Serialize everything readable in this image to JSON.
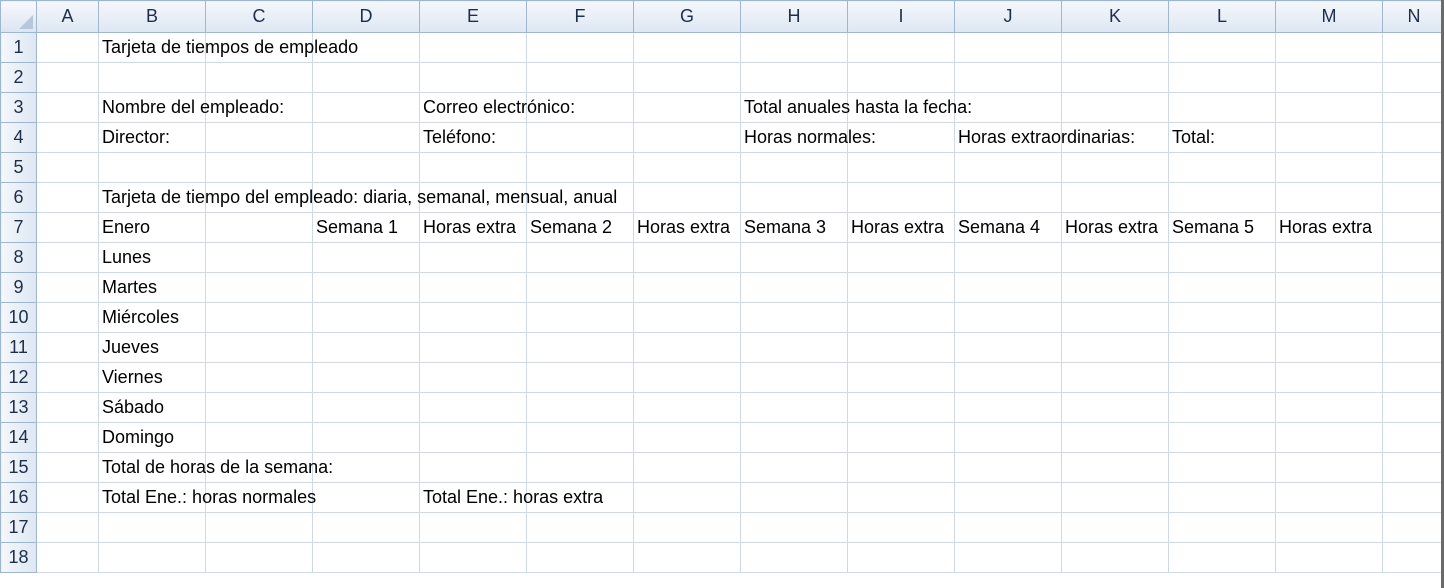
{
  "columns": [
    "A",
    "B",
    "C",
    "D",
    "E",
    "F",
    "G",
    "H",
    "I",
    "J",
    "K",
    "L",
    "M",
    "N"
  ],
  "rows": [
    {
      "num": "1",
      "cells": {
        "B": "Tarjeta de tiempos de empleado"
      }
    },
    {
      "num": "2",
      "cells": {}
    },
    {
      "num": "3",
      "cells": {
        "B": "Nombre del empleado:",
        "E": "Correo electrónico:",
        "H": "Total anuales hasta la fecha:"
      }
    },
    {
      "num": "4",
      "cells": {
        "B": "Director:",
        "E": "Teléfono:",
        "H": "Horas normales:",
        "J": "Horas extraordinarias:",
        "L": "Total:"
      }
    },
    {
      "num": "5",
      "cells": {}
    },
    {
      "num": "6",
      "cells": {
        "B": "Tarjeta de tiempo del empleado: diaria, semanal, mensual, anual"
      }
    },
    {
      "num": "7",
      "cells": {
        "B": "Enero",
        "D": "Semana 1",
        "E": "Horas extra",
        "F": "Semana 2",
        "G": "Horas extra",
        "H": "Semana 3",
        "I": "Horas extra",
        "J": "Semana 4",
        "K": "Horas extra",
        "L": "Semana 5",
        "M": "Horas extra"
      }
    },
    {
      "num": "8",
      "cells": {
        "B": "Lunes"
      }
    },
    {
      "num": "9",
      "cells": {
        "B": "Martes"
      }
    },
    {
      "num": "10",
      "cells": {
        "B": "Miércoles"
      }
    },
    {
      "num": "11",
      "cells": {
        "B": "Jueves"
      }
    },
    {
      "num": "12",
      "cells": {
        "B": "Viernes"
      }
    },
    {
      "num": "13",
      "cells": {
        "B": "Sábado"
      }
    },
    {
      "num": "14",
      "cells": {
        "B": "Domingo"
      }
    },
    {
      "num": "15",
      "cells": {
        "B": "Total de horas de la semana:"
      }
    },
    {
      "num": "16",
      "cells": {
        "B": "Total Ene.: horas normales",
        "E": "Total Ene.: horas extra"
      }
    },
    {
      "num": "17",
      "cells": {}
    },
    {
      "num": "18",
      "cells": {}
    }
  ]
}
